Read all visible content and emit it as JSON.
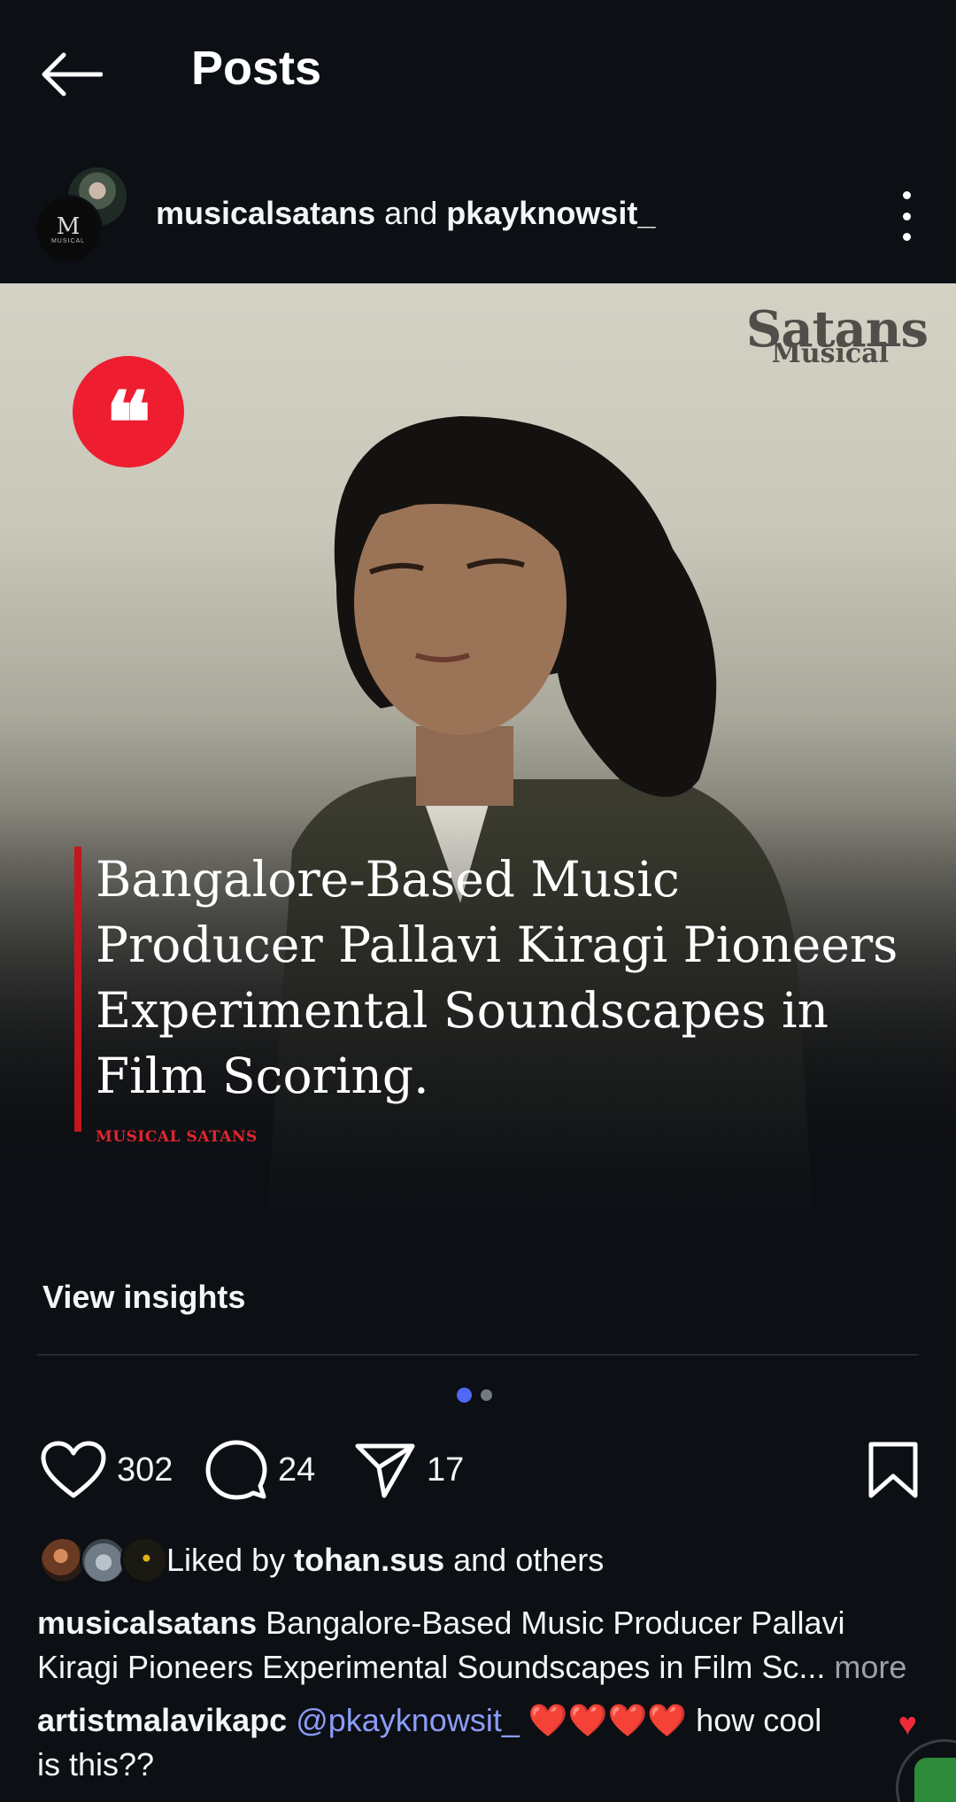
{
  "header": {
    "title": "Posts",
    "back_icon": "arrow-left-icon"
  },
  "post": {
    "user_primary": "musicalsatans",
    "joiner": "and",
    "user_secondary": "pkayknowsit_",
    "avatar_logo_letter": "M",
    "avatar_logo_text": "MUSICAL"
  },
  "media": {
    "brand_line1": "Satans",
    "brand_line2": "Musical",
    "quote_glyph": "❝",
    "headline": "Bangalore-Based Music Producer Pallavi Kiragi Pioneers Experimental Soundscapes in Film Scoring.",
    "source": "MUSICAL SATANS",
    "colors": {
      "quote_badge": "#ee1d2f",
      "accent_bar": "#c4161f"
    }
  },
  "insights": {
    "label": "View insights"
  },
  "carousel": {
    "total": 2,
    "active": 1,
    "active_color": "#4f68f5"
  },
  "actions": {
    "likes": "302",
    "comments": "24",
    "shares": "17"
  },
  "liked_by": {
    "prefix": "Liked by",
    "user": "tohan.sus",
    "suffix": "and others"
  },
  "caption": {
    "user": "musicalsatans",
    "text": "Bangalore-Based Music Producer Pallavi Kiragi Pioneers Experimental Soundscapes in Film Sc...",
    "more": "more"
  },
  "top_comment": {
    "user": "artistmalavikapc",
    "mention": "@pkayknowsit_",
    "hearts": "❤️❤️❤️❤️",
    "text": "how cool is this??",
    "like_icon": "♥"
  }
}
